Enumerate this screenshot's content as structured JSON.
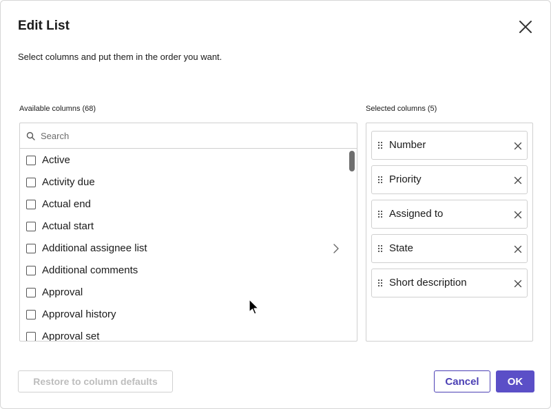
{
  "dialog": {
    "title": "Edit List",
    "subtitle": "Select columns and put them in the order you want."
  },
  "available": {
    "label": "Available columns (68)",
    "search_placeholder": "Search",
    "items": [
      {
        "label": "Active",
        "checked": false
      },
      {
        "label": "Activity due",
        "checked": false
      },
      {
        "label": "Actual end",
        "checked": false
      },
      {
        "label": "Actual start",
        "checked": false
      },
      {
        "label": "Additional assignee list",
        "checked": false,
        "has_submenu": true
      },
      {
        "label": "Additional comments",
        "checked": false
      },
      {
        "label": "Approval",
        "checked": false
      },
      {
        "label": "Approval history",
        "checked": false
      },
      {
        "label": "Approval set",
        "checked": false
      }
    ]
  },
  "selected": {
    "label": "Selected columns (5)",
    "items": [
      {
        "label": "Number"
      },
      {
        "label": "Priority"
      },
      {
        "label": "Assigned to"
      },
      {
        "label": "State"
      },
      {
        "label": "Short description"
      }
    ]
  },
  "footer": {
    "restore_label": "Restore to column defaults",
    "cancel_label": "Cancel",
    "ok_label": "OK"
  },
  "colors": {
    "accent": "#5b4fc7",
    "cancel_text": "#4a3fb4",
    "disabled_text": "#bdbdbd"
  },
  "icons": {
    "close": "close-icon",
    "search": "search-icon",
    "chevron": "chevron-right-icon",
    "drag": "drag-handle-icon",
    "remove": "remove-icon"
  }
}
